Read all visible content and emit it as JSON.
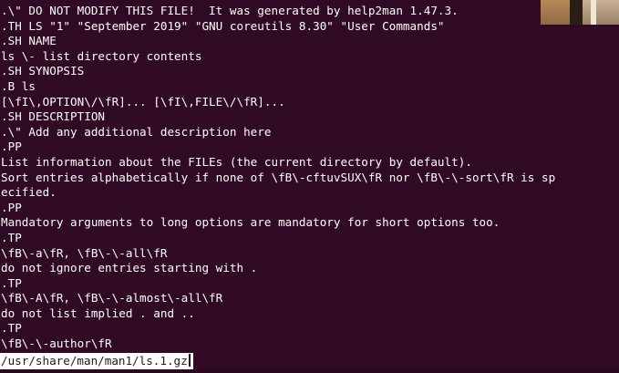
{
  "terminal": {
    "lines": [
      ".\\\" DO NOT MODIFY THIS FILE!  It was generated by help2man 1.47.3.",
      ".TH LS \"1\" \"September 2019\" \"GNU coreutils 8.30\" \"User Commands\"",
      ".SH NAME",
      "ls \\- list directory contents",
      ".SH SYNOPSIS",
      ".B ls",
      "[\\fI\\,OPTION\\/\\fR]... [\\fI\\,FILE\\/\\fR]...",
      ".SH DESCRIPTION",
      ".\\\" Add any additional description here",
      ".PP",
      "List information about the FILEs (the current directory by default).",
      "Sort entries alphabetically if none of \\fB\\-cftuvSUX\\fR nor \\fB\\-\\-sort\\fR is sp",
      "ecified.",
      ".PP",
      "Mandatory arguments to long options are mandatory for short options too.",
      ".TP",
      "\\fB\\-a\\fR, \\fB\\-\\-all\\fR",
      "do not ignore entries starting with .",
      ".TP",
      "\\fB\\-A\\fR, \\fB\\-\\-almost\\-all\\fR",
      "do not list implied . and ..",
      ".TP",
      "\\fB\\-\\-author\\fR"
    ],
    "status_path": "/usr/share/man/man1/ls.1.gz"
  },
  "colors": {
    "background": "#300a24",
    "foreground": "#ffffff",
    "status_background": "#ffffff",
    "status_foreground": "#1b1b1b"
  }
}
